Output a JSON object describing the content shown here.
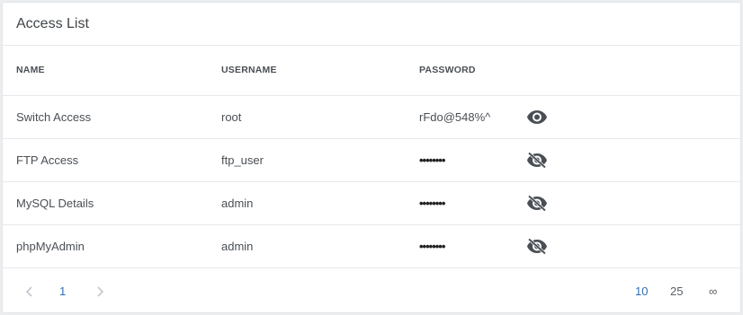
{
  "card": {
    "title": "Access List"
  },
  "table": {
    "headers": [
      "NAME",
      "USERNAME",
      "PASSWORD"
    ],
    "rows": [
      {
        "name": "Switch Access",
        "username": "root",
        "password": "rFdo@548%^",
        "visible": true,
        "toggle_icon": "eye-icon"
      },
      {
        "name": "FTP Access",
        "username": "ftp_user",
        "password": "••••••••",
        "visible": false,
        "toggle_icon": "eye-off-icon"
      },
      {
        "name": "MySQL Details",
        "username": "admin",
        "password": "••••••••",
        "visible": false,
        "toggle_icon": "eye-off-icon"
      },
      {
        "name": "phpMyAdmin",
        "username": "admin",
        "password": "••••••••",
        "visible": false,
        "toggle_icon": "eye-off-icon"
      }
    ]
  },
  "pagination": {
    "current_page": "1",
    "prev_icon": "chevron-left-icon",
    "next_icon": "chevron-right-icon",
    "page_sizes": [
      "10",
      "25",
      "∞"
    ],
    "selected_size": "10"
  },
  "colors": {
    "accent": "#2f6fb3",
    "text": "#4a4f55",
    "border": "#e7e9ec",
    "icon": "#4a4f55"
  }
}
